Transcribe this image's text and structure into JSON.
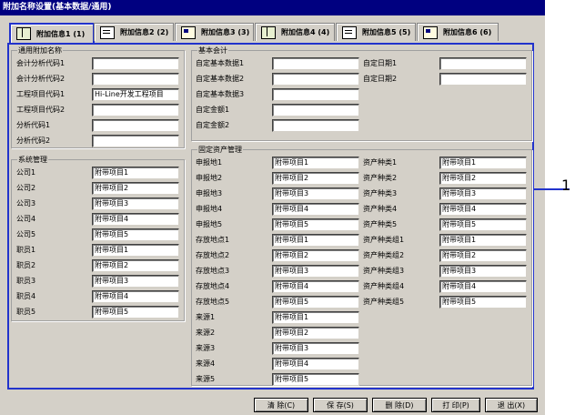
{
  "window": {
    "title": "附加名称设置(基本数据/通用)"
  },
  "tabs": [
    {
      "label": "附加信息1 (1)",
      "icon": "book-icon"
    },
    {
      "label": "附加信息2 (2)",
      "icon": "document-icon"
    },
    {
      "label": "附加信息3 (3)",
      "icon": "card-icon"
    },
    {
      "label": "附加信息4 (4)",
      "icon": "book-icon"
    },
    {
      "label": "附加信息5 (5)",
      "icon": "document-icon"
    },
    {
      "label": "附加信息6 (6)",
      "icon": "card-icon"
    }
  ],
  "general": {
    "title": "通用附加名称",
    "rows": [
      {
        "label": "会计分析代码1",
        "value": ""
      },
      {
        "label": "会计分析代码2",
        "value": ""
      },
      {
        "label": "工程项目代码1",
        "value": "Hi-Line开发工程项目"
      },
      {
        "label": "工程项目代码2",
        "value": ""
      },
      {
        "label": "分析代码1",
        "value": ""
      },
      {
        "label": "分析代码2",
        "value": ""
      }
    ]
  },
  "system": {
    "title": "系统管理",
    "rows": [
      {
        "label": "公司1",
        "value": "附带项目1"
      },
      {
        "label": "公司2",
        "value": "附带项目2"
      },
      {
        "label": "公司3",
        "value": "附带项目3"
      },
      {
        "label": "公司4",
        "value": "附带项目4"
      },
      {
        "label": "公司5",
        "value": "附带项目5"
      },
      {
        "label": "职员1",
        "value": "附带项目1"
      },
      {
        "label": "职员2",
        "value": "附带项目2"
      },
      {
        "label": "职员3",
        "value": "附带项目3"
      },
      {
        "label": "职员4",
        "value": "附带项目4"
      },
      {
        "label": "职员5",
        "value": "附带项目5"
      }
    ]
  },
  "basic": {
    "title": "基本会计",
    "left": [
      {
        "label": "自定基本数据1",
        "value": ""
      },
      {
        "label": "自定基本数据2",
        "value": ""
      },
      {
        "label": "自定基本数据3",
        "value": ""
      },
      {
        "label": "自定金额1",
        "value": ""
      },
      {
        "label": "自定金额2",
        "value": ""
      }
    ],
    "right": [
      {
        "label": "自定日期1",
        "value": ""
      },
      {
        "label": "自定日期2",
        "value": ""
      }
    ]
  },
  "asset": {
    "title": "固定资产管理",
    "left": [
      {
        "label": "申报地1",
        "value": "附带项目1"
      },
      {
        "label": "申报地2",
        "value": "附带项目2"
      },
      {
        "label": "申报地3",
        "value": "附带项目3"
      },
      {
        "label": "申报地4",
        "value": "附带项目4"
      },
      {
        "label": "申报地5",
        "value": "附带项目5"
      },
      {
        "label": "存放地点1",
        "value": "附带项目1"
      },
      {
        "label": "存放地点2",
        "value": "附带项目2"
      },
      {
        "label": "存放地点3",
        "value": "附带项目3"
      },
      {
        "label": "存放地点4",
        "value": "附带项目4"
      },
      {
        "label": "存放地点5",
        "value": "附带项目5"
      },
      {
        "label": "来源1",
        "value": "附带项目1"
      },
      {
        "label": "来源2",
        "value": "附带项目2"
      },
      {
        "label": "来源3",
        "value": "附带项目3"
      },
      {
        "label": "来源4",
        "value": "附带项目4"
      },
      {
        "label": "来源5",
        "value": "附带项目5"
      }
    ],
    "right": [
      {
        "label": "资产种类1",
        "value": "附带项目1"
      },
      {
        "label": "资产种类2",
        "value": "附带项目2"
      },
      {
        "label": "资产种类3",
        "value": "附带项目3"
      },
      {
        "label": "资产种类4",
        "value": "附带项目4"
      },
      {
        "label": "资产种类5",
        "value": "附带项目5"
      },
      {
        "label": "资产种类组1",
        "value": "附带项目1"
      },
      {
        "label": "资产种类组2",
        "value": "附带项目2"
      },
      {
        "label": "资产种类组3",
        "value": "附带项目3"
      },
      {
        "label": "资产种类组4",
        "value": "附带项目4"
      },
      {
        "label": "资产种类组5",
        "value": "附带项目5"
      }
    ]
  },
  "buttons": [
    {
      "label": "清 除(C)"
    },
    {
      "label": "保 存(S)"
    },
    {
      "label": "删 除(D)"
    },
    {
      "label": "打 印(P)"
    },
    {
      "label": "退 出(X)"
    }
  ],
  "callout": {
    "number": "1"
  },
  "colors": {
    "title_bar": "#000080",
    "highlight": "#2233cc",
    "window_bg": "#d4d0c8"
  }
}
